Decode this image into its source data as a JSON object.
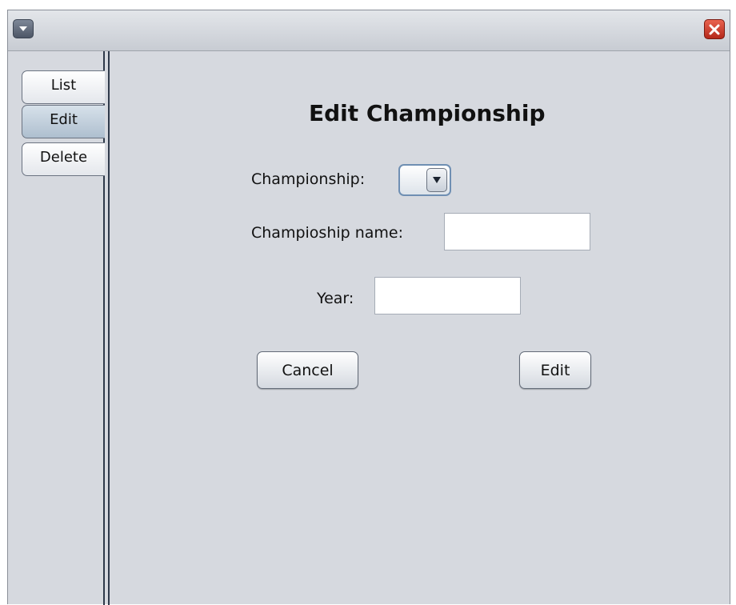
{
  "tabs": [
    {
      "label": "List"
    },
    {
      "label": "Edit"
    },
    {
      "label": "Delete"
    }
  ],
  "selected_tab": "Edit",
  "form": {
    "title": "Edit Championship",
    "championship_label": "Championship:",
    "championship_value": "",
    "name_label": "Champioship name:",
    "name_value": "",
    "year_label": "Year:",
    "year_value": "",
    "cancel_label": "Cancel",
    "edit_label": "Edit"
  },
  "icons": {
    "window_menu": "chevron-down-icon",
    "close": "close-icon",
    "combo_arrow": "triangle-down-icon"
  },
  "colors": {
    "background": "#d6d9df",
    "close_button": "#d0402e",
    "selected_tab": "#b9c8d6"
  }
}
